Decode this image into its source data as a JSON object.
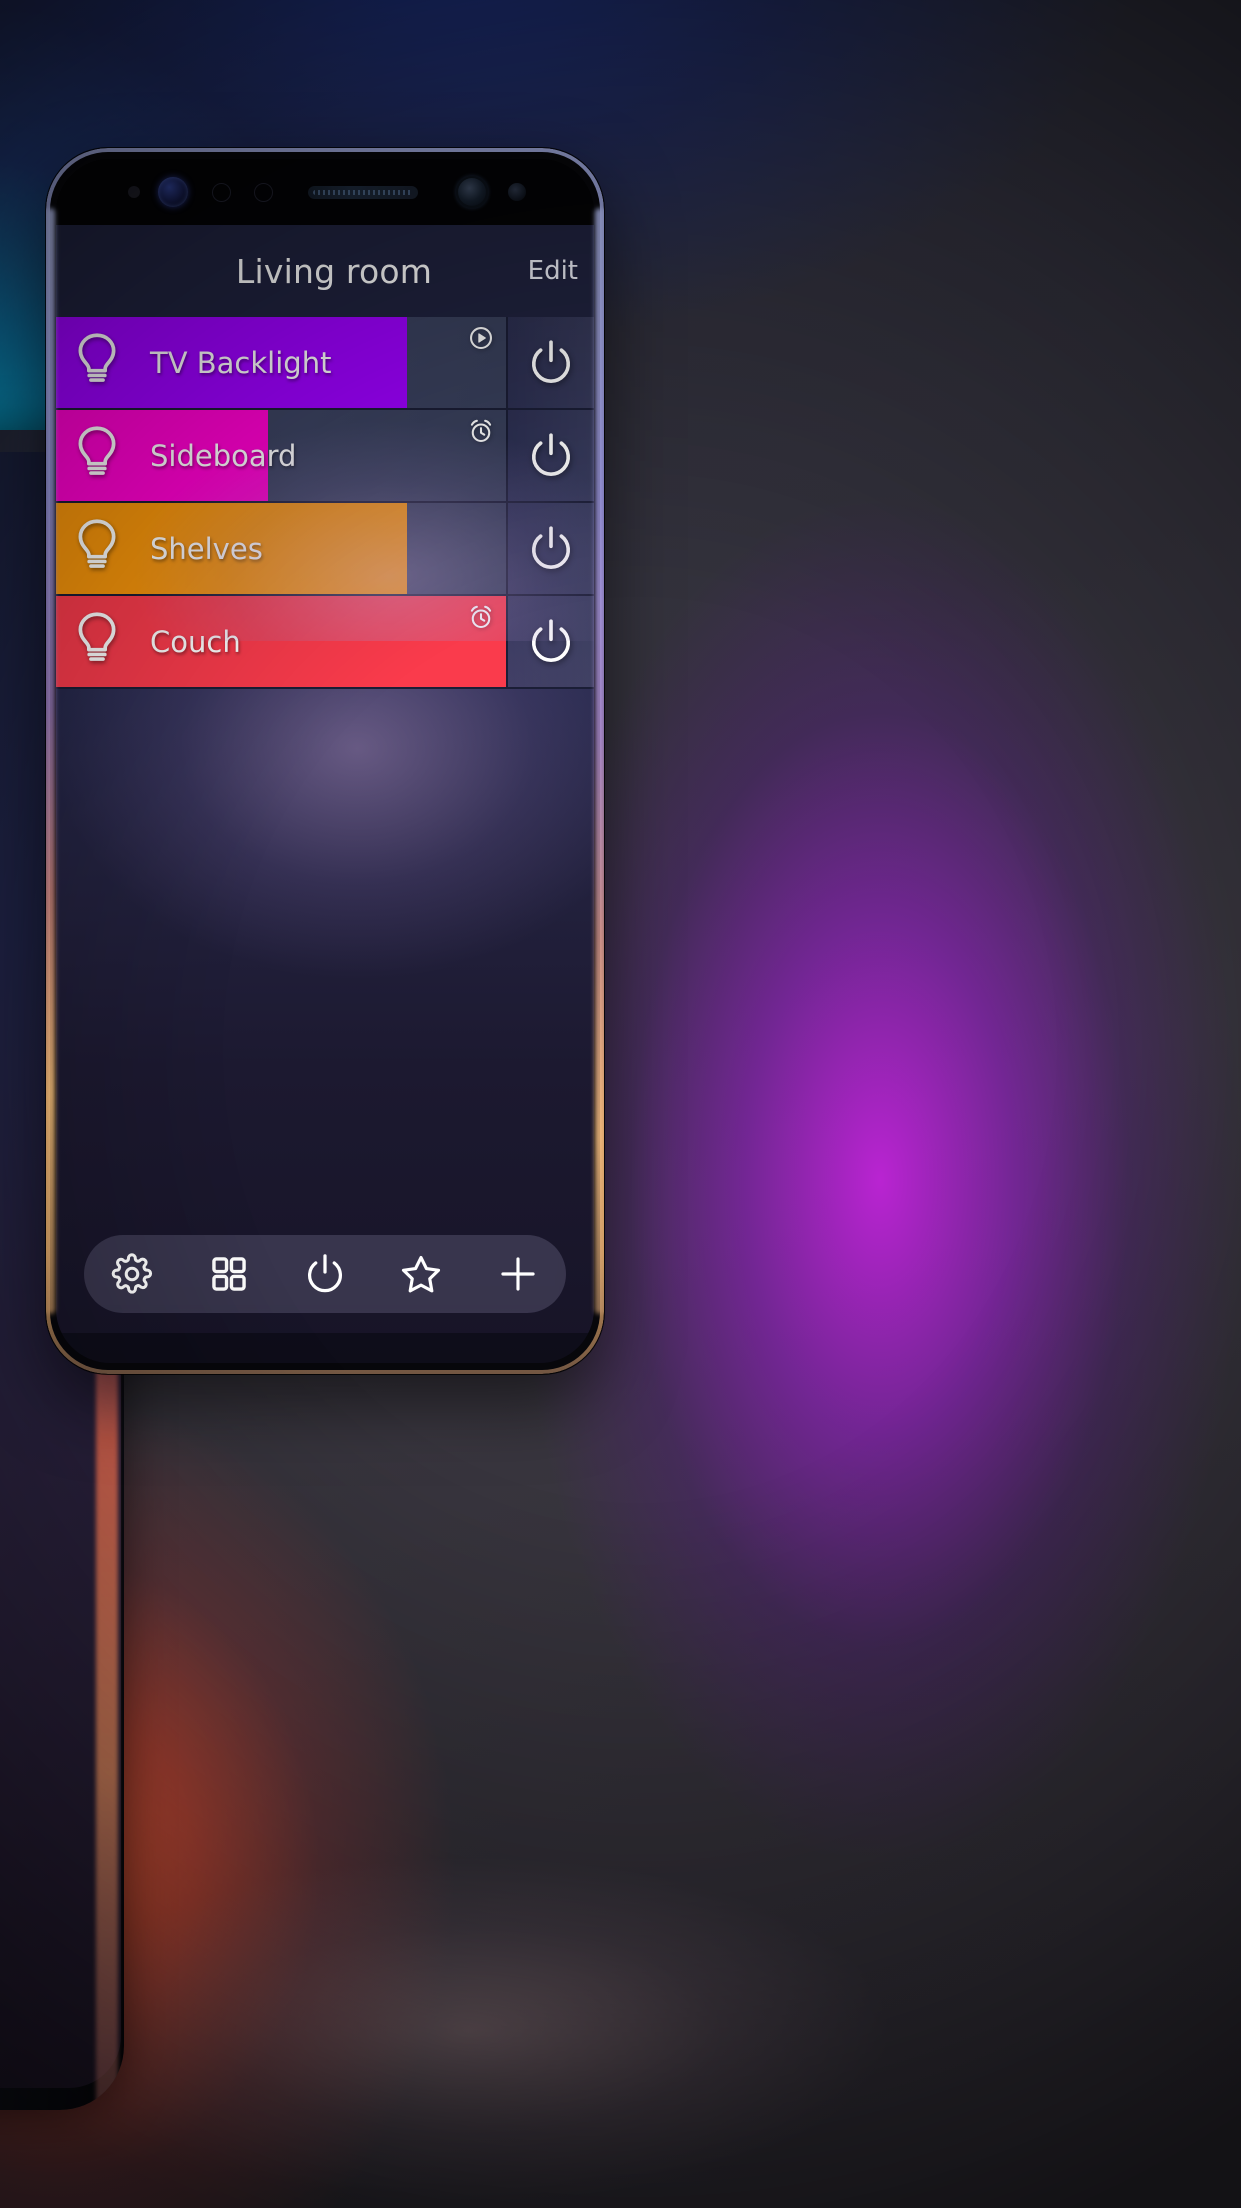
{
  "app": {
    "title": "Living room",
    "edit_label": "Edit"
  },
  "lights": [
    {
      "name": "TV Backlight",
      "color": "#9E00FF",
      "brightness_percent": 78,
      "badge": "play-circle-icon",
      "power_state": "on",
      "icon": "bulb-icon",
      "power_icon": "power-icon"
    },
    {
      "name": "Sideboard",
      "color": "#FF00D0",
      "brightness_percent": 47,
      "badge": "alarm-clock-icon",
      "power_state": "on",
      "icon": "bulb-icon",
      "power_icon": "power-icon"
    },
    {
      "name": "Shelves",
      "color": "#F7950B",
      "brightness_percent": 78,
      "badge": "",
      "power_state": "on",
      "icon": "bulb-icon",
      "power_icon": "power-icon"
    },
    {
      "name": "Couch",
      "color": "#FA3B4C",
      "brightness_percent": 100,
      "badge": "alarm-clock-icon",
      "power_state": "on",
      "icon": "bulb-icon",
      "power_icon": "power-icon"
    }
  ],
  "toolbar": {
    "items": [
      {
        "icon": "gear-icon",
        "label": "Settings"
      },
      {
        "icon": "grid-icon",
        "label": "Groups"
      },
      {
        "icon": "power-icon",
        "label": "All power"
      },
      {
        "icon": "star-icon",
        "label": "Favorites"
      },
      {
        "icon": "plus-icon",
        "label": "Add"
      }
    ]
  },
  "device": {
    "sensors": [
      "proximity-sensor-dot",
      "iris-scanner-icon",
      "sensor-ring-icon",
      "sensor-ring-icon",
      "earpiece-speaker-icon",
      "front-camera-icon",
      "led-indicator-icon"
    ]
  },
  "theme": {
    "header_bg": "#20233F",
    "track_bg": "#3B4260",
    "screen_bg": "#23264A",
    "text": "#FFFFFF"
  }
}
